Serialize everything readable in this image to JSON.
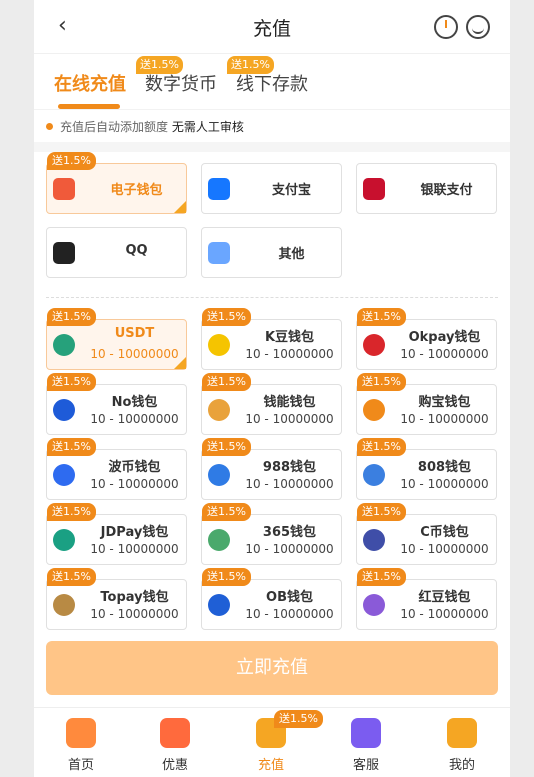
{
  "header": {
    "title": "充值",
    "back_icon": "chevron-left-icon",
    "clock_icon": "clock-history-icon",
    "service_icon": "customer-service-icon"
  },
  "tabs": [
    {
      "label": "在线充值",
      "badge": "送1.5%"
    },
    {
      "label": "数字货币",
      "badge": "送1.5%"
    },
    {
      "label": "线下存款"
    }
  ],
  "notice": {
    "text": "充值后自动添加额度",
    "highlight": "无需人工审核"
  },
  "methods": [
    {
      "label": "电子钱包",
      "badge": "送1.5%",
      "icon": "wallet-icon",
      "color": "#f05a3a",
      "selected": true
    },
    {
      "label": "支付宝",
      "icon": "alipay-icon",
      "color": "#1677ff"
    },
    {
      "label": "银联支付",
      "icon": "unionpay-icon",
      "color": "#c8102e"
    },
    {
      "label": "QQ",
      "icon": "qq-penguin-icon",
      "color": "#222222"
    },
    {
      "label": "其他",
      "icon": "card-icon",
      "color": "#6aa6ff"
    }
  ],
  "channels": [
    {
      "name": "USDT",
      "range": "10 - 10000000",
      "badge": "送1.5%",
      "icon": "usdt-icon",
      "color": "#26a17b",
      "selected": true
    },
    {
      "name": "K豆钱包",
      "range": "10 - 10000000",
      "badge": "送1.5%",
      "icon": "kdou-icon",
      "color": "#f5c400"
    },
    {
      "name": "Okpay钱包",
      "range": "10 - 10000000",
      "badge": "送1.5%",
      "icon": "okpay-icon",
      "color": "#d9262b"
    },
    {
      "name": "No钱包",
      "range": "10 - 10000000",
      "badge": "送1.5%",
      "icon": "no-wallet-icon",
      "color": "#1e5bd8"
    },
    {
      "name": "钱能钱包",
      "range": "10 - 10000000",
      "badge": "送1.5%",
      "icon": "qianneng-icon",
      "color": "#e9a23b"
    },
    {
      "name": "购宝钱包",
      "range": "10 - 10000000",
      "badge": "送1.5%",
      "icon": "goubao-icon",
      "color": "#f08a1a"
    },
    {
      "name": "波币钱包",
      "range": "10 - 10000000",
      "badge": "送1.5%",
      "icon": "bobi-icon",
      "color": "#2e6bf0"
    },
    {
      "name": "988钱包",
      "range": "10 - 10000000",
      "badge": "送1.5%",
      "icon": "988-icon",
      "color": "#2f7be5"
    },
    {
      "name": "808钱包",
      "range": "10 - 10000000",
      "badge": "送1.5%",
      "icon": "808-icon",
      "color": "#3b7fe0"
    },
    {
      "name": "JDPay钱包",
      "range": "10 - 10000000",
      "badge": "送1.5%",
      "icon": "jdpay-icon",
      "color": "#1aa083"
    },
    {
      "name": "365钱包",
      "range": "10 - 10000000",
      "badge": "送1.5%",
      "icon": "365-icon",
      "color": "#4aa96c"
    },
    {
      "name": "C币钱包",
      "range": "10 - 10000000",
      "badge": "送1.5%",
      "icon": "cbi-icon",
      "color": "#3f4ea8"
    },
    {
      "name": "Topay钱包",
      "range": "10 - 10000000",
      "badge": "送1.5%",
      "icon": "topay-icon",
      "color": "#b88a44"
    },
    {
      "name": "OB钱包",
      "range": "10 - 10000000",
      "badge": "送1.5%",
      "icon": "ob-icon",
      "color": "#1f5fd6"
    },
    {
      "name": "红豆钱包",
      "range": "10 - 10000000",
      "badge": "送1.5%",
      "icon": "hongdou-icon",
      "color": "#8a5ad8"
    }
  ],
  "cta": {
    "label": "立即充值"
  },
  "nav": [
    {
      "label": "首页",
      "icon": "home-icon",
      "color": "#ff8a3d"
    },
    {
      "label": "优惠",
      "icon": "gift-icon",
      "color": "#ff6a3d"
    },
    {
      "label": "充值",
      "icon": "wallet-icon",
      "color": "#f5a623",
      "active": true,
      "badge": "送1.5%"
    },
    {
      "label": "客服",
      "icon": "headset-icon",
      "color": "#7b5cf0"
    },
    {
      "label": "我的",
      "icon": "user-icon",
      "color": "#f5a623"
    }
  ],
  "colors": {
    "accent": "#f08a1a",
    "cta": "#ffc587"
  }
}
